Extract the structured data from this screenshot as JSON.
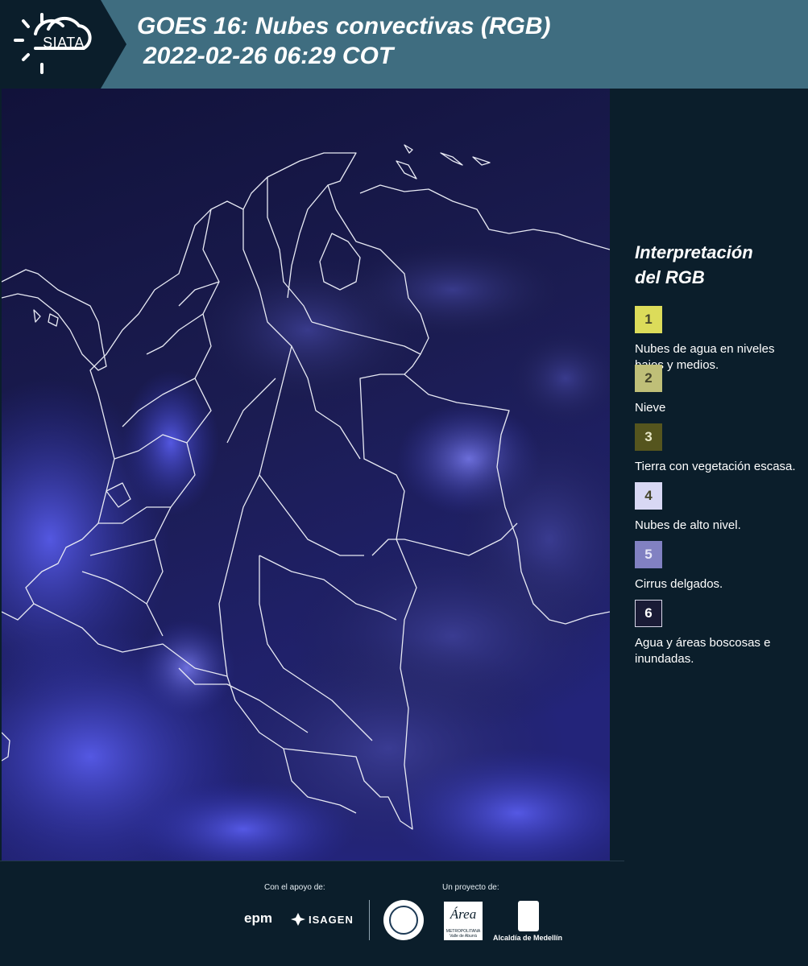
{
  "header": {
    "logo_text": "SIATA",
    "title_line1": "GOES 16: Nubes convectivas (RGB)",
    "title_line2": "2022-02-26 06:29 COT"
  },
  "legend": {
    "title_line1": "Interpretación",
    "title_line2": "del RGB",
    "items": [
      {
        "num": "1",
        "color": "#dcdc5a",
        "text": "Nubes de agua en niveles bajos y medios."
      },
      {
        "num": "2",
        "color": "#bfbf78",
        "text": "Nieve"
      },
      {
        "num": "3",
        "color": "#55551e",
        "text": "Tierra con vegetación escasa."
      },
      {
        "num": "4",
        "color": "#d8d8f4",
        "text": "Nubes de alto nivel."
      },
      {
        "num": "5",
        "color": "#8181c2",
        "text": "Cirrus delgados."
      },
      {
        "num": "6",
        "color": "#1a1b36",
        "text": "Agua y áreas boscosas e inundadas."
      }
    ]
  },
  "footer": {
    "support_label": "Con el apoyo de:",
    "project_label": "Un proyecto de:",
    "epm": "epm",
    "isagen": "ISAGEN",
    "area_name": "Área",
    "area_sub": "METROPOLITANA Valle de Aburrá",
    "alcaldia": "Alcaldía de Medellín"
  },
  "colors": {
    "header_bg": "#3f6d80",
    "page_bg": "#0b1e2b",
    "map_base": "#15163f",
    "cloud_blue": "#3f45d8"
  }
}
